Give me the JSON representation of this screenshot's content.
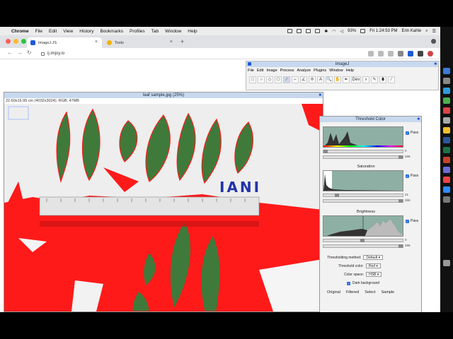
{
  "menubar": {
    "app": "Chrome",
    "items": [
      "File",
      "Edit",
      "View",
      "History",
      "Bookmarks",
      "Profiles",
      "Tab",
      "Window",
      "Help"
    ],
    "battery": "93%",
    "datetime": "Fri 1:24:53 PM",
    "user": "Erin Kahle"
  },
  "tabs": [
    {
      "label": "ImageJ.JS"
    },
    {
      "label": "Tools"
    }
  ],
  "address": {
    "url": "ij.imjoy.io"
  },
  "imagej": {
    "title": "ImageJ",
    "menu": [
      "File",
      "Edit",
      "Image",
      "Process",
      "Analyze",
      "Plugins",
      "Window",
      "Help"
    ],
    "tools": [
      "□",
      "○",
      "◇",
      "⬠",
      "∕",
      "⌐",
      "∠",
      "✢",
      "A",
      "🔍",
      "✋",
      "✒",
      "Dev",
      "⌕",
      "✎",
      "⬮",
      "⁄"
    ]
  },
  "image_window": {
    "title": "leaf sample.jpg (25%)",
    "info": "22.60x16.95 cm (4032x3024); RGB; 47MB",
    "annotation": "IANI"
  },
  "threshold": {
    "title": "Threshold Color",
    "pass": "Pass",
    "hue_vals": [
      "0",
      "255"
    ],
    "saturation_label": "Saturation",
    "sat_vals": [
      "21",
      "255"
    ],
    "brightness_label": "Brightness",
    "bri_vals": [
      "0",
      "255"
    ],
    "method_label": "Thresholding method:",
    "method_value": "Default",
    "color_label": "Threshold color:",
    "color_value": "Red",
    "space_label": "Color space:",
    "space_value": "HSB",
    "dark_bg": "Dark background",
    "buttons": [
      "Original",
      "Filtered",
      "Select",
      "Sample"
    ]
  },
  "colors": {
    "accent": "#1e5ad6",
    "threshold_red": "#ff1a1a",
    "leaf": "#3f7a3a"
  }
}
